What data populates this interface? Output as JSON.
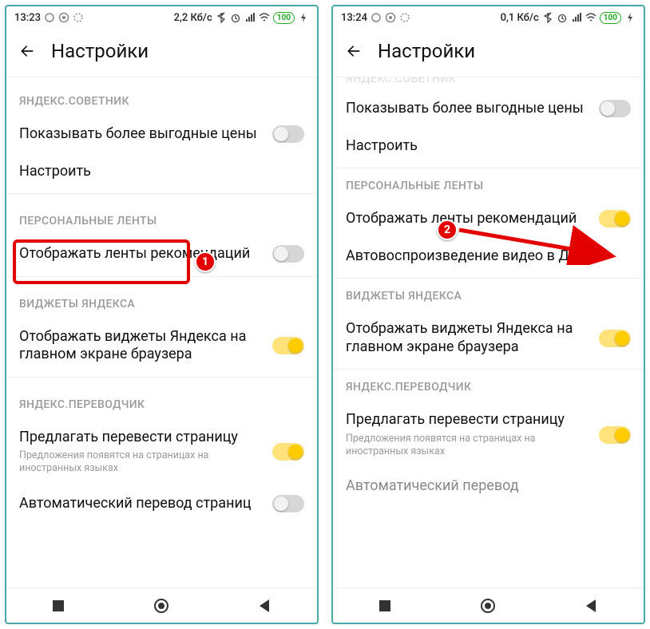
{
  "left": {
    "status": {
      "time": "13:23",
      "net": "2,2 Кб/с",
      "battery": "100"
    },
    "header": {
      "title": "Настройки"
    },
    "sec_advisor": {
      "title": "ЯНДЕКС.СОВЕТНИК",
      "row_prices": "Показывать более выгодные цены",
      "row_config": "Настроить"
    },
    "sec_feeds": {
      "title": "ПЕРСОНАЛЬНЫЕ ЛЕНТЫ",
      "row_show": "Отображать ленты рекомендаций"
    },
    "sec_widgets": {
      "title": "ВИДЖЕТЫ ЯНДЕКСА",
      "row_show": "Отображать виджеты Яндекса на главном экране браузера"
    },
    "sec_translate": {
      "title": "ЯНДЕКС.ПЕРЕВОДЧИК",
      "row_offer": "Предлагать перевести страницу",
      "row_offer_sub": "Предложения появятся на страницах на иностранных языках",
      "row_auto": "Автоматический перевод страниц"
    },
    "callout1": "1"
  },
  "right": {
    "status": {
      "time": "13:24",
      "net": "0,1 Кб/с",
      "battery": "100"
    },
    "header": {
      "title": "Настройки"
    },
    "cutoff_top": "ЯНДЕКС.СОВЕТНИК",
    "sec_advisor": {
      "row_prices": "Показывать более выгодные цены",
      "row_config": "Настроить"
    },
    "sec_feeds": {
      "title": "ПЕРСОНАЛЬНЫЕ ЛЕНТЫ",
      "row_show": "Отображать ленты рекомендаций",
      "row_video": "Автовоспроизведение видео в Дзене"
    },
    "sec_widgets": {
      "title": "ВИДЖЕТЫ ЯНДЕКСА",
      "row_show": "Отображать виджеты Яндекса на главном экране браузера"
    },
    "sec_translate": {
      "title": "ЯНДЕКС.ПЕРЕВОДЧИК",
      "row_offer": "Предлагать перевести страницу",
      "row_offer_sub": "Предложения появятся на страницах на иностранных языках",
      "row_auto": "Автоматический перевод"
    },
    "callout2": "2"
  }
}
